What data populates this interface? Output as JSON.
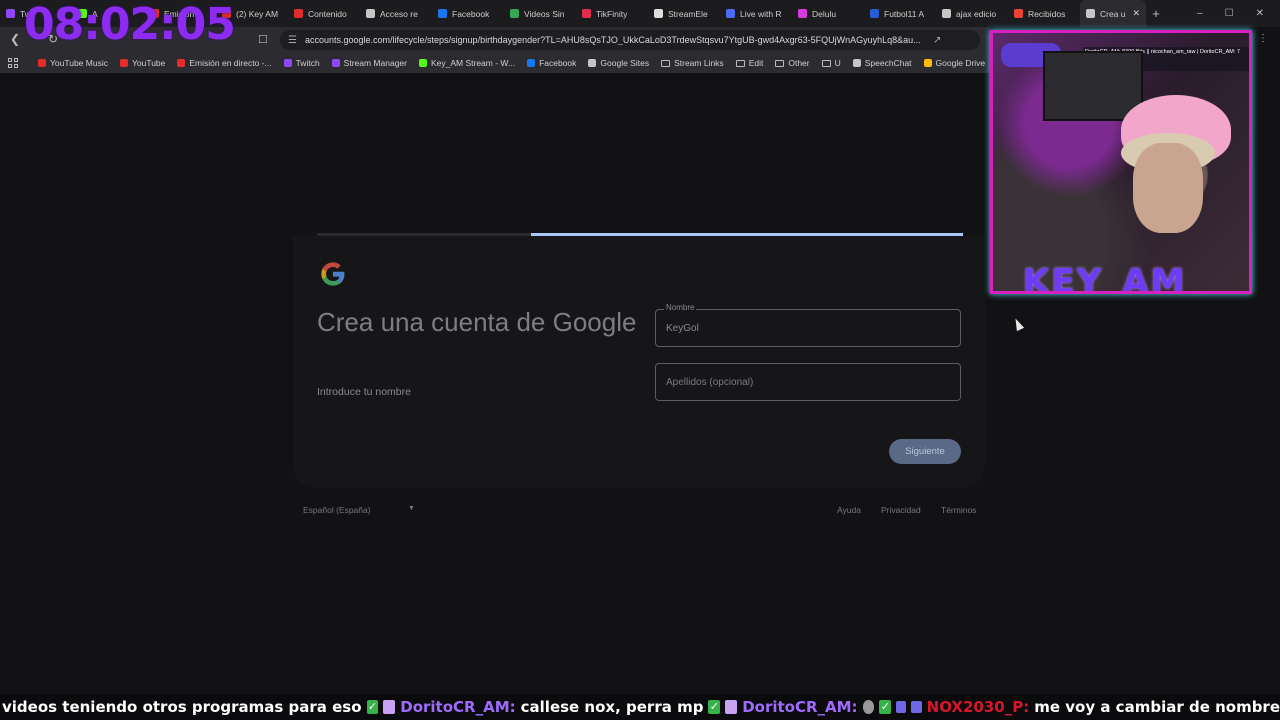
{
  "clock": "08:02:05",
  "tabs": [
    {
      "label": "Tw",
      "color": "#9146ff"
    },
    {
      "label": "A",
      "color": "#53fc18"
    },
    {
      "label": "Emisión",
      "color": "#e32c2c"
    },
    {
      "label": "(2) Key AM",
      "color": "#e32c2c"
    },
    {
      "label": "Contenido",
      "color": "#e32c2c"
    },
    {
      "label": "Acceso re",
      "color": "#c6c6c6"
    },
    {
      "label": "Facebook",
      "color": "#1877f2"
    },
    {
      "label": "Videos Sin",
      "color": "#34a853"
    },
    {
      "label": "TikFinity",
      "color": "#e32c4f"
    },
    {
      "label": "StreamEle",
      "color": "#dddddd"
    },
    {
      "label": "Live with R",
      "color": "#4a6cf7"
    },
    {
      "label": "Delulu",
      "color": "#d93ae0"
    },
    {
      "label": "Futbol11 A",
      "color": "#2a5bd7"
    },
    {
      "label": "ajax edicio",
      "color": "#c6c6c6"
    },
    {
      "label": "Recibidos",
      "color": "#ea4335"
    },
    {
      "label": "Crea u",
      "color": "#c6c6c6",
      "active": true
    }
  ],
  "url": "accounts.google.com/lifecycle/steps/signup/birthdaygender?TL=AHU8sQsTJO_UkkCaLoD3TrdewStqsvu7YtgUB-gwd4Axgr63-5FQUjWnAGyuyhLq8&au...",
  "bookmarks": [
    {
      "label": "YouTube Music",
      "type": "site",
      "color": "#e32c2c"
    },
    {
      "label": "YouTube",
      "type": "site",
      "color": "#e32c2c"
    },
    {
      "label": "Emisión en directo -...",
      "type": "site",
      "color": "#e32c2c"
    },
    {
      "label": "Twitch",
      "type": "site",
      "color": "#9146ff"
    },
    {
      "label": "Stream Manager",
      "type": "site",
      "color": "#9146ff"
    },
    {
      "label": "Key_AM Stream - W...",
      "type": "site",
      "color": "#53fc18"
    },
    {
      "label": "Facebook",
      "type": "site",
      "color": "#1877f2"
    },
    {
      "label": "Google Sites",
      "type": "site",
      "color": "#c6c6c6"
    },
    {
      "label": "Stream Links",
      "type": "folder"
    },
    {
      "label": "Edit",
      "type": "folder"
    },
    {
      "label": "Other",
      "type": "folder"
    },
    {
      "label": "U",
      "type": "folder"
    },
    {
      "label": "SpeechChat",
      "type": "site",
      "color": "#c6c6c6"
    },
    {
      "label": "Google Drive",
      "type": "site",
      "color": "#fbbc04"
    }
  ],
  "signup": {
    "title": "Crea una cuenta de Google",
    "subtitle": "Introduce tu nombre",
    "first_name_label": "Nombre",
    "first_name_value": "KeyGol",
    "last_name_placeholder": "Apellidos (opcional)",
    "next_button": "Siguiente",
    "progress": 0.67
  },
  "footer": {
    "language": "Español (España)",
    "help": "Ayuda",
    "privacy": "Privacidad",
    "terms": "Términos"
  },
  "overlay": {
    "brand": "KEY_AM",
    "small_text": "DoritoCR_AM: 8300 Bits || nicochan_am_raw | DoritoCR_AM: 7 SUBS | DoritoCR_AM"
  },
  "ticker": {
    "text1": "videos teniendo otros programas para eso",
    "user1": "DoritoCR_AM:",
    "text2": "callese nox, perra mp",
    "user2": "DoritoCR_AM:",
    "user3": "NOX2030_P:",
    "text3": "me voy a cambiar de nombre"
  }
}
